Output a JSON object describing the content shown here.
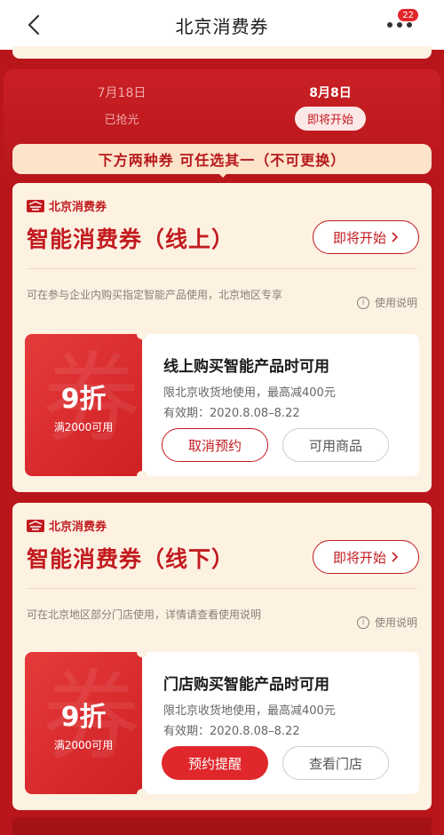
{
  "nav": {
    "title": "北京消费券",
    "badge_count": "22"
  },
  "dates": [
    {
      "date": "7月18日",
      "status": "已抢光"
    },
    {
      "date": "8月8日",
      "status": "即将开始"
    }
  ],
  "notice": "下方两种券 可任选其一（不可更换）",
  "cards": [
    {
      "brand": "北京消费券",
      "title": "智能消费券（线上）",
      "start_label": "即将开始",
      "description": "可在参与企业内购买指定智能产品使用，北京地区专享",
      "usage_label": "使用说明",
      "coupon": {
        "discount": "9折",
        "threshold": "满2000可用",
        "heading": "线上购买智能产品时可用",
        "line1": "限北京收货地使用，最高减400元",
        "line2": "有效期：2020.8.08–8.22",
        "btn1": "取消预约",
        "btn2": "可用商品"
      }
    },
    {
      "brand": "北京消费券",
      "title": "智能消费券（线下）",
      "start_label": "即将开始",
      "description": "可在北京地区部分门店使用，详情请查看使用说明",
      "usage_label": "使用说明",
      "coupon": {
        "discount": "9折",
        "threshold": "满2000可用",
        "heading": "门店购买智能产品时可用",
        "line1": "限北京收货地使用，最高减400元",
        "line2": "有效期：2020.8.08–8.22",
        "btn1": "预约提醒",
        "btn2": "查看门店"
      }
    }
  ],
  "colors": {
    "brand_red": "#c21b1f",
    "panel_red": "#b8161b",
    "cream": "#fdf1e2"
  }
}
